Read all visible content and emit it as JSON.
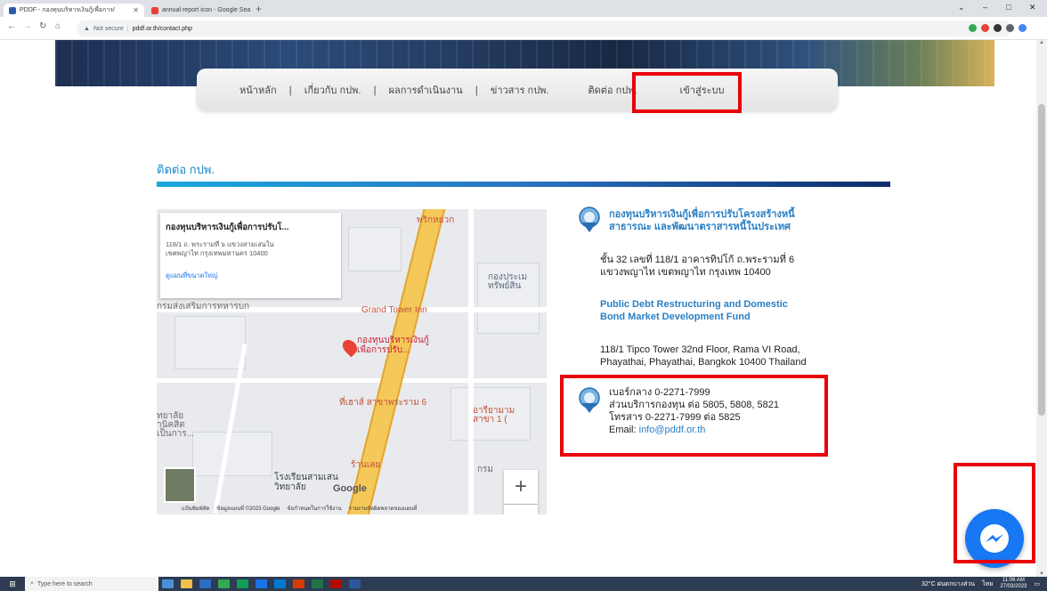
{
  "browser": {
    "tabs": [
      {
        "title": "PDDF - กองทุนบริหารเงินกู้เพื่อการ/",
        "active": true,
        "color": "#2a5ba8"
      },
      {
        "title": "annual report icon - Google Sea",
        "active": false,
        "color": "#ea4335"
      }
    ],
    "url_warning": "Not secure",
    "url": "pddf.or.th/contact.php",
    "new_tab": "+",
    "controls": {
      "min": "–",
      "max": "□",
      "close": "✕",
      "chevron": "⌄"
    }
  },
  "nav": {
    "items": [
      "หน้าหลัก",
      "เกี่ยวกับ กปพ.",
      "ผลการดำเนินงาน",
      "ข่าวสาร กปพ.",
      "ติดต่อ กปพ.",
      "เข้าสู่ระบบ"
    ],
    "separator": "|"
  },
  "page": {
    "title": "ติดต่อ กปพ."
  },
  "map": {
    "card_title": "กองทุนบริหารเงินกู้เพื่อการปรับโ...",
    "card_addr_1": "118/1 ถ. พระรามที่ ๖ แขวงสามเสนใน",
    "card_addr_2": "เขตพญาไท กรุงเทพมหานคร 10400",
    "card_link": "ดูแผนที่ขนาดใหญ่",
    "labels": {
      "phrikhyuak": "พริกหยวก",
      "grand_tower": "Grand Tower Inn",
      "pin_1": "กองทุนบริหารเงินกู้",
      "pin_2": "เพื่อการปรับ...",
      "fund_1": "กองประเม",
      "fund_2": "ทรัพย์สิน",
      "rama6": "ที่เฮาส์ สาขาพระราม 6",
      "school_1": "โรงเรียนสามเสน",
      "school_2": "วิทยาลัย",
      "shop": "ร้านเลย",
      "left_1": "กรมส่งเสริมการทหารบก",
      "left_2": "ทยาลัย",
      "left_3": "านิคสิต",
      "left_4": "เป็นการ...",
      "ari": "อารียามาม",
      "ari_2": "สาขา 1 (",
      "kram": "กรม",
      "google": "Google"
    },
    "zoom_in": "+",
    "zoom_out": "−",
    "footer": [
      "แป้นพิมพ์ลัด",
      "ข้อมูลแผนที่ ©2023 Google",
      "ข้อกำหนดในการใช้งาน",
      "รายงานข้อผิดพลาดของแผนที่"
    ]
  },
  "contact": {
    "org_th_1": "กองทุนบริหารเงินกู้เพื่อการปรับโครงสร้างหนี้",
    "org_th_2": "สาธารณะ และพัฒนาตราสารหนี้ในประเทศ",
    "addr_th_1": "ชั้น 32 เลขที่ 118/1 อาคารทิปโก้ ถ.พระรามที่ 6",
    "addr_th_2": "แขวงพญาไท เขตพญาไท กรุงเทพ 10400",
    "org_en_1": "Public Debt Restructuring and Domestic",
    "org_en_2": "Bond Market Development Fund",
    "addr_en_1": "118/1 Tipco Tower 32nd Floor, Rama VI Road,",
    "addr_en_2": "Phayathai, Phayathai, Bangkok 10400 Thailand",
    "phone_main": "เบอร์กลาง 0-2271-7999",
    "phone_service": "ส่วนบริการกองทุน ต่อ 5805, 5808, 5821",
    "fax": "โทรสาร 0-2271-7999 ต่อ 5825",
    "email_label": "Email: ",
    "email": "info@pddf.or.th"
  },
  "taskbar": {
    "search_placeholder": "Type here to search",
    "weather": "32°C ฝนตกบางส่วน",
    "lang": "ไทย",
    "time": "11:06 AM",
    "date": "27/03/2023"
  },
  "colors": {
    "accent": "#2a7fc4",
    "highlight": "#e8000b",
    "messenger": "#1877f2"
  }
}
